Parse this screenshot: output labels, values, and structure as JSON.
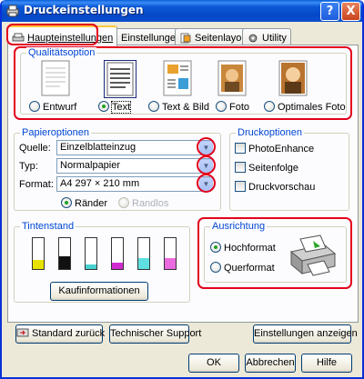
{
  "window": {
    "title": "Druckeinstellungen",
    "help_label": "?",
    "close_label": "X"
  },
  "tabs": [
    {
      "label": "Haupteinstellungen",
      "icon": "printer-icon",
      "active": true
    },
    {
      "label": "Einstellungen",
      "icon": "settings-icon",
      "active": false
    },
    {
      "label": "Seitenlayout",
      "icon": "page-layout-icon",
      "active": false
    },
    {
      "label": "Utility",
      "icon": "utility-icon",
      "active": false
    }
  ],
  "quality": {
    "legend": "Qualitätsoption",
    "options": [
      {
        "label": "Entwurf",
        "selected": false
      },
      {
        "label": "Text",
        "selected": true
      },
      {
        "label": "Text & Bild",
        "selected": false
      },
      {
        "label": "Foto",
        "selected": false
      },
      {
        "label": "Optimales Foto",
        "selected": false
      }
    ]
  },
  "paper": {
    "legend": "Papieroptionen",
    "source_label": "Quelle:",
    "source_value": "Einzelblatteinzug",
    "type_label": "Typ:",
    "type_value": "Normalpapier",
    "format_label": "Format:",
    "format_value": "A4 297 × 210 mm",
    "margins_label": "Ränder",
    "borderless_label": "Randlos"
  },
  "print_options": {
    "legend": "Druckoptionen",
    "photo_enhance": "PhotoEnhance",
    "page_order": "Seitenfolge",
    "preview": "Druckvorschau"
  },
  "ink": {
    "legend": "Tintenstand",
    "levels": [
      {
        "color": "#e7e200",
        "level": 0.3
      },
      {
        "color": "#111111",
        "level": 0.4
      },
      {
        "color": "#49d1d1",
        "level": 0.15
      },
      {
        "color": "#d02ad0",
        "level": 0.2
      },
      {
        "color": "#5fe0e0",
        "level": 0.35
      },
      {
        "color": "#ea6ae0",
        "level": 0.35
      }
    ],
    "purchase_label": "Kaufinformationen"
  },
  "orientation": {
    "legend": "Ausrichtung",
    "portrait": "Hochformat",
    "landscape": "Querformat",
    "selected": "portrait"
  },
  "buttons": {
    "reset": "Standard zurück",
    "support": "Technischer Support",
    "show_settings": "Einstellungen anzeigen",
    "ok": "OK",
    "cancel": "Abbrechen",
    "help": "Hilfe"
  }
}
